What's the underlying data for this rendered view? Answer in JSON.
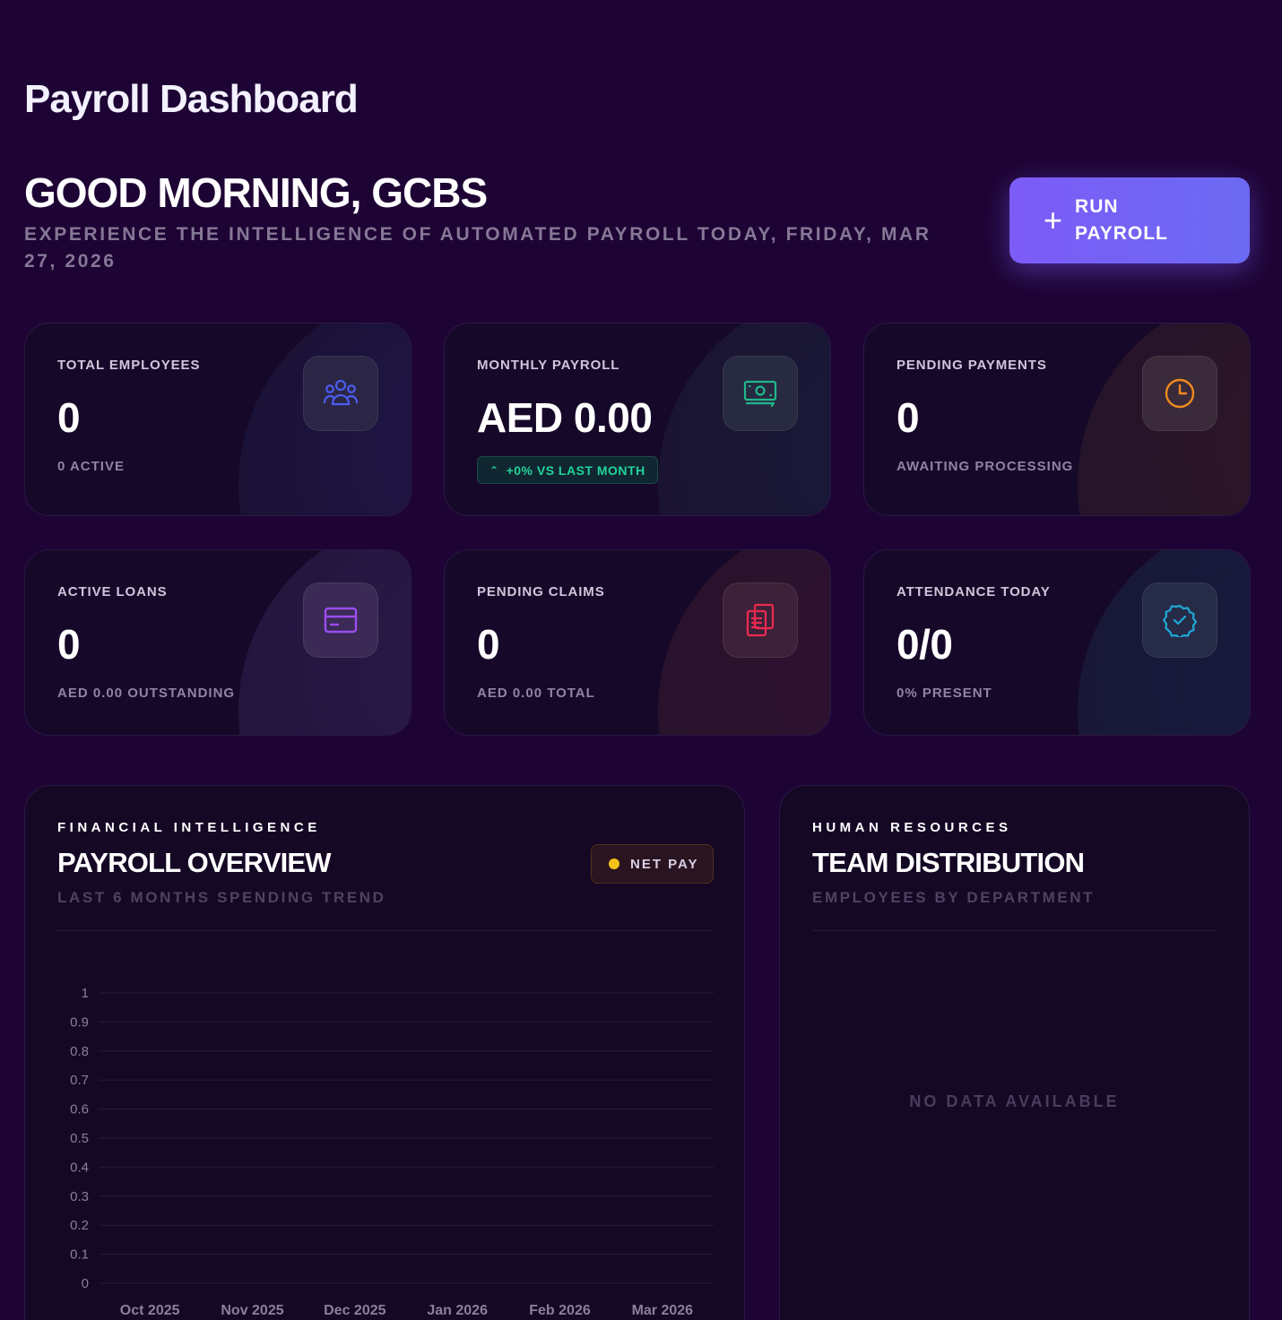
{
  "header": {
    "title": "Payroll Dashboard",
    "greeting": "GOOD MORNING, GCBS",
    "subtitle": "EXPERIENCE THE INTELLIGENCE OF AUTOMATED PAYROLL TODAY, FRIDAY, MAR 27, 2026",
    "run_button": {
      "icon": "plus-icon",
      "label": "RUN PAYROLL"
    }
  },
  "stats": [
    {
      "title": "TOTAL EMPLOYEES",
      "value": "0",
      "sub": "0 ACTIVE",
      "icon": "users-icon",
      "color": "#4b5cf0"
    },
    {
      "title": "MONTHLY PAYROLL",
      "value": "AED 0.00",
      "trend": "+0% VS LAST MONTH",
      "icon": "money-icon",
      "color": "#1fb78a"
    },
    {
      "title": "PENDING PAYMENTS",
      "value": "0",
      "sub": "AWAITING PROCESSING",
      "icon": "clock-icon",
      "color": "#f08a1c"
    },
    {
      "title": "ACTIVE LOANS",
      "value": "0",
      "sub": "AED 0.00 OUTSTANDING",
      "icon": "credit-card-icon",
      "color": "#9b4df2"
    },
    {
      "title": "PENDING CLAIMS",
      "value": "0",
      "sub": "AED 0.00 TOTAL",
      "icon": "documents-icon",
      "color": "#ec2a52"
    },
    {
      "title": "ATTENDANCE TODAY",
      "value": "0/0",
      "sub": "0% PRESENT",
      "icon": "badge-check-icon",
      "color": "#1fa8d6"
    }
  ],
  "payroll_panel": {
    "eyebrow": "FINANCIAL INTELLIGENCE",
    "title": "PAYROLL OVERVIEW",
    "subtitle": "LAST 6 MONTHS SPENDING TREND",
    "legend": "NET PAY",
    "legend_color": "#f5c316"
  },
  "team_panel": {
    "eyebrow": "HUMAN RESOURCES",
    "title": "TEAM DISTRIBUTION",
    "subtitle": "EMPLOYEES BY DEPARTMENT",
    "empty": "NO DATA AVAILABLE"
  },
  "chart_data": {
    "type": "line",
    "categories": [
      "Oct 2025",
      "Nov 2025",
      "Dec 2025",
      "Jan 2026",
      "Feb 2026",
      "Mar 2026"
    ],
    "series": [
      {
        "name": "NET PAY",
        "values": [
          0,
          0,
          0,
          0,
          0,
          0
        ]
      }
    ],
    "y_ticks": [
      "0",
      "0.1",
      "0.2",
      "0.3",
      "0.4",
      "0.5",
      "0.6",
      "0.7",
      "0.8",
      "0.9",
      "1"
    ],
    "ylim": [
      0,
      1
    ],
    "grid": true
  }
}
